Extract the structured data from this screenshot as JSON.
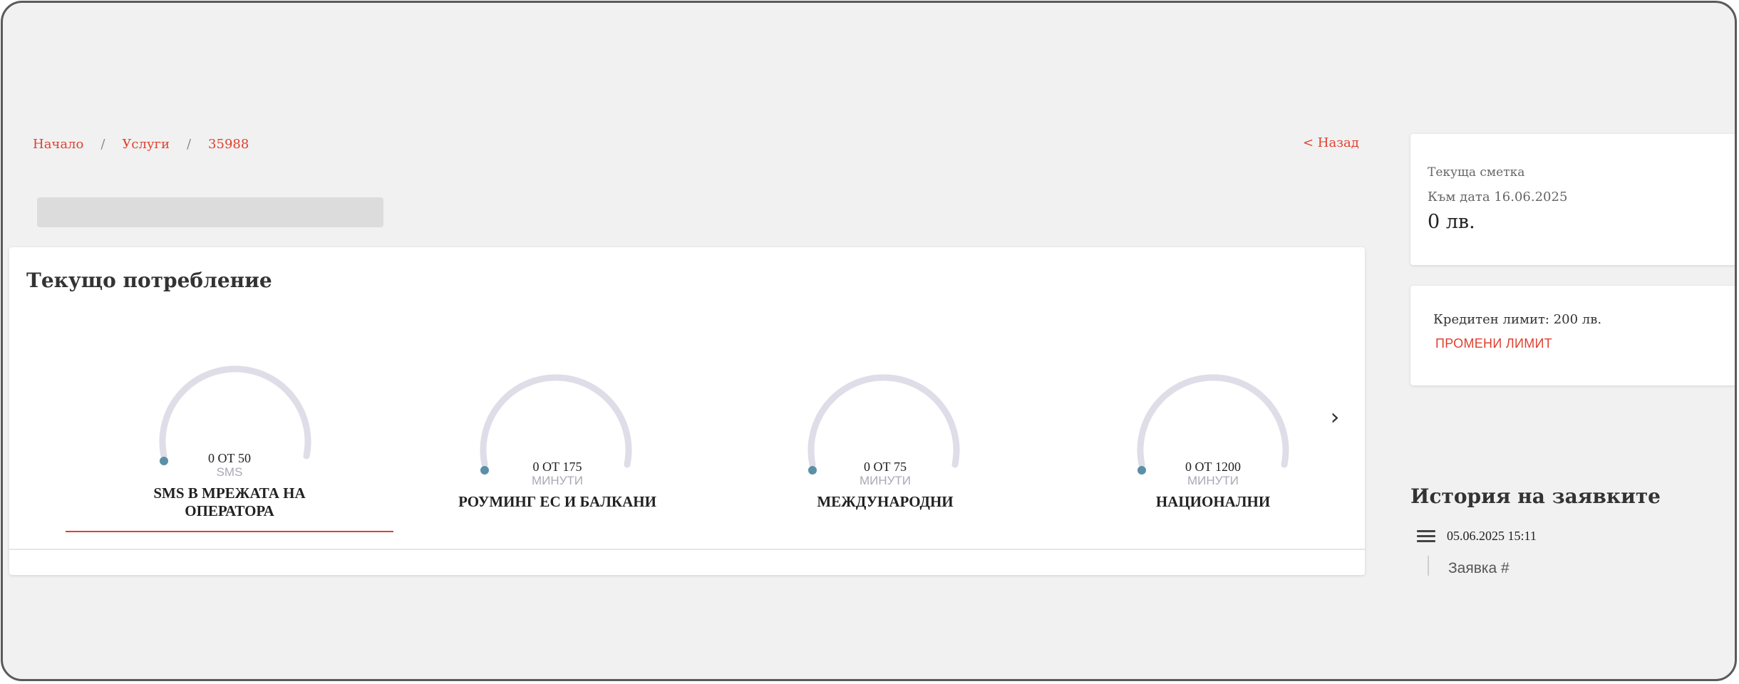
{
  "breadcrumb": {
    "home": "Начало",
    "services": "Услуги",
    "current": "35988",
    "separator": "/"
  },
  "back_link": "< Назад",
  "usage": {
    "title": "Текущо потребление",
    "next_icon": "chevron-right-icon",
    "gauges": [
      {
        "amount": "0 ОТ 50",
        "unit": "SMS",
        "label_line1": "SMS В МРЕЖАТА НА",
        "label_line2": "ОПЕРАТОРА",
        "used": 0,
        "total": 50,
        "active": true
      },
      {
        "amount": "0 ОТ 175",
        "unit": "МИНУТИ",
        "label_line1": "РОУМИНГ ЕС И БАЛКАНИ",
        "label_line2": "",
        "used": 0,
        "total": 175,
        "active": false
      },
      {
        "amount": "0 ОТ 75",
        "unit": "МИНУТИ",
        "label_line1": "МЕЖДУНАРОДНИ",
        "label_line2": "",
        "used": 0,
        "total": 75,
        "active": false
      },
      {
        "amount": "0 ОТ 1200",
        "unit": "МИНУТИ",
        "label_line1": "НАЦИОНАЛНИ",
        "label_line2": "",
        "used": 0,
        "total": 1200,
        "active": false
      }
    ]
  },
  "account": {
    "label": "Текуща сметка",
    "date": "Към дата 16.06.2025",
    "amount": "0 лв."
  },
  "credit": {
    "limit": "Кредитен лимит: 200 лв.",
    "change_button": "ПРОМЕНИ ЛИМИТ"
  },
  "history": {
    "title": "История на заявките",
    "entry_date": "05.06.2025 15:11",
    "entry_request": "Заявка #",
    "entry_icon": "menu-icon"
  },
  "colors": {
    "accent": "#e0402f",
    "gauge_track": "#dedde8",
    "gauge_dot": "#5b8fa8",
    "background": "#f1f1f1"
  }
}
